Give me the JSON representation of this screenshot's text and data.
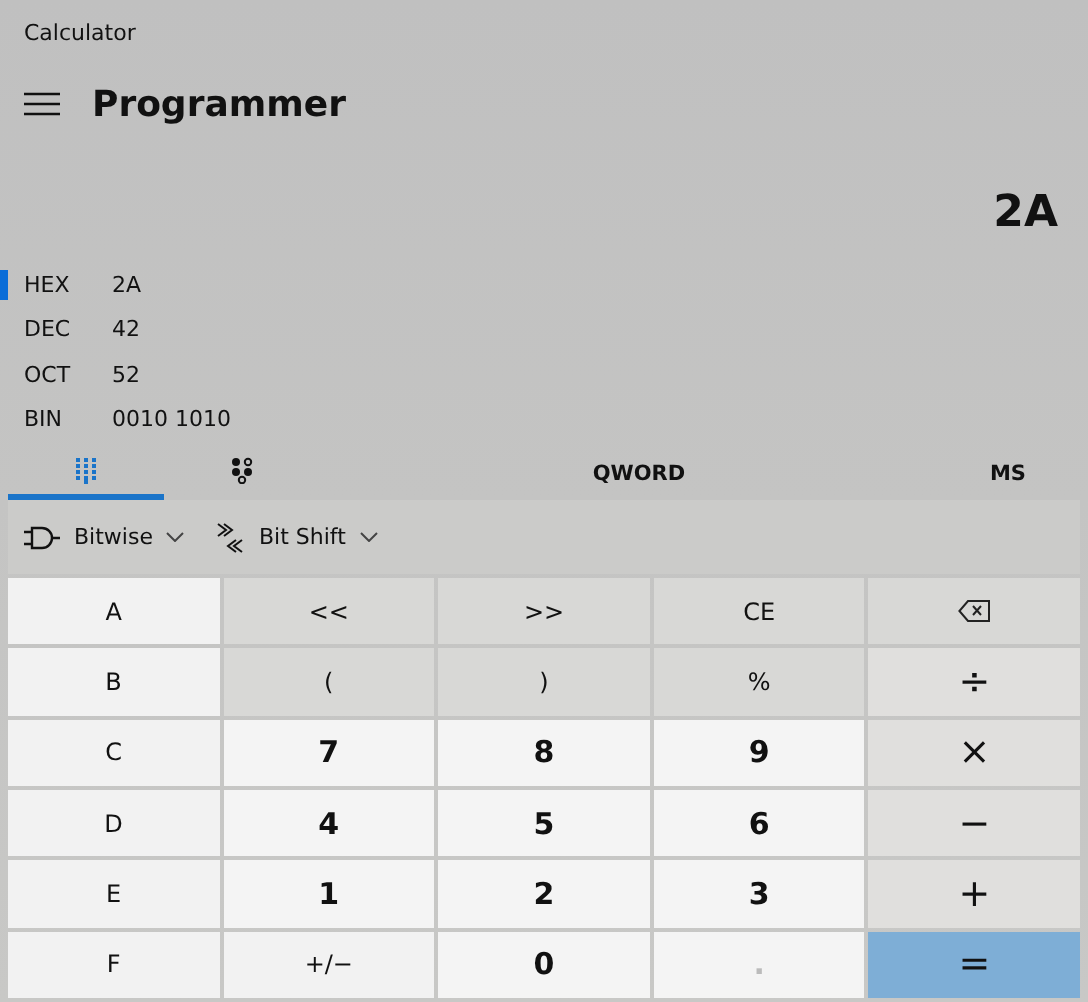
{
  "window": {
    "title": "Calculator"
  },
  "header": {
    "mode": "Programmer"
  },
  "display": {
    "value": "2A"
  },
  "radix": [
    {
      "label": "HEX",
      "value": "2A",
      "selected": true
    },
    {
      "label": "DEC",
      "value": "42",
      "selected": false
    },
    {
      "label": "OCT",
      "value": "52",
      "selected": false
    },
    {
      "label": "BIN",
      "value": "0010 1010",
      "selected": false
    }
  ],
  "tabs": [
    {
      "kind": "keypad",
      "selected": true
    },
    {
      "kind": "bits",
      "selected": false
    }
  ],
  "word_size": "QWORD",
  "memory": "MS",
  "toolbar": [
    {
      "kind": "bitwise",
      "label": "Bitwise"
    },
    {
      "kind": "shift",
      "label": "Bit Shift"
    }
  ],
  "keys": [
    {
      "label": "A",
      "kind": "letter"
    },
    {
      "label": "<<",
      "kind": "func"
    },
    {
      "label": ">>",
      "kind": "func"
    },
    {
      "label": "CE",
      "kind": "func"
    },
    {
      "kind": "backspace"
    },
    {
      "label": "B",
      "kind": "letter"
    },
    {
      "label": "(",
      "kind": "func"
    },
    {
      "label": ")",
      "kind": "func"
    },
    {
      "label": "%",
      "kind": "func"
    },
    {
      "label": "÷",
      "kind": "op"
    },
    {
      "label": "C",
      "kind": "letter"
    },
    {
      "label": "7",
      "kind": "digit"
    },
    {
      "label": "8",
      "kind": "digit"
    },
    {
      "label": "9",
      "kind": "digit"
    },
    {
      "label": "×",
      "kind": "op"
    },
    {
      "label": "D",
      "kind": "letter"
    },
    {
      "label": "4",
      "kind": "digit"
    },
    {
      "label": "5",
      "kind": "digit"
    },
    {
      "label": "6",
      "kind": "digit"
    },
    {
      "label": "−",
      "kind": "op"
    },
    {
      "label": "E",
      "kind": "letter"
    },
    {
      "label": "1",
      "kind": "digit"
    },
    {
      "label": "2",
      "kind": "digit"
    },
    {
      "label": "3",
      "kind": "digit"
    },
    {
      "label": "+",
      "kind": "op"
    },
    {
      "label": "F",
      "kind": "letter"
    },
    {
      "label": "+/−",
      "kind": "letter"
    },
    {
      "label": "0",
      "kind": "digit"
    },
    {
      "label": ".",
      "kind": "digit",
      "disabled": true
    },
    {
      "label": "=",
      "kind": "equals"
    }
  ]
}
